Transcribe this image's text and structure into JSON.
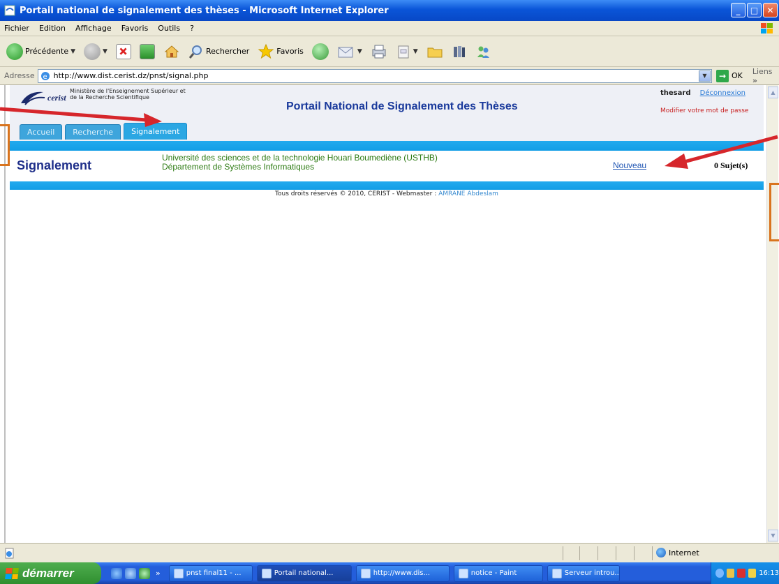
{
  "window": {
    "title": "Portail national de signalement des thèses - Microsoft Internet Explorer",
    "buttons": {
      "minimize": "_",
      "maximize": "□",
      "close": "✕"
    }
  },
  "menu": [
    "Fichier",
    "Edition",
    "Affichage",
    "Favoris",
    "Outils",
    "?"
  ],
  "toolbar": {
    "back_label": "Précédente",
    "search_label": "Rechercher",
    "favorites_label": "Favoris"
  },
  "address": {
    "label": "Adresse",
    "url": "http://www.dist.cerist.dz/pnst/signal.php",
    "go_label": "OK",
    "links_label": "Liens",
    "links_more": "»"
  },
  "page": {
    "logo_text": "cerist",
    "ministry": "Ministère de l'Enseignement Supérieur et de la Recherche Scientifique",
    "portal_title": "Portail National de Signalement des Thèses",
    "username": "thesard",
    "logout_label": "Déconnexion",
    "change_password": "Modifier votre mot de passe",
    "tabs": [
      {
        "label": "Accueil",
        "active": false
      },
      {
        "label": "Recherche",
        "active": false
      },
      {
        "label": "Signalement",
        "active": true
      }
    ],
    "section_title": "Signalement",
    "university_line1": "Université des sciences et de la technologie Houari Boumediène (USTHB)",
    "university_line2": "Département de Systèmes Informatiques",
    "new_link": "Nouveau",
    "subject_count": "0 Sujet(s)",
    "footer_text": "Tous droits réservés © 2010, CERIST - Webmaster : ",
    "footer_webmaster": "AMRANE Abdeslam"
  },
  "status": {
    "zone": "Internet"
  },
  "taskbar": {
    "start_label": "démarrer",
    "quicklaunch_more": "»",
    "tasks": [
      {
        "label": "pnst final11 - ...",
        "active": false
      },
      {
        "label": "Portail national...",
        "active": true
      },
      {
        "label": "http://www.dis...",
        "active": false
      },
      {
        "label": "notice - Paint",
        "active": false
      },
      {
        "label": "Serveur introu...",
        "active": false
      }
    ],
    "clock": "16:13"
  },
  "colors": {
    "portal_title": "#1a3a9c",
    "tab_blue": "#2ba7e3",
    "university_green": "#2c7a12",
    "password_red": "#c81d1d",
    "annotation_arrow": "#d6262b",
    "annotation_box": "#d9741e"
  }
}
